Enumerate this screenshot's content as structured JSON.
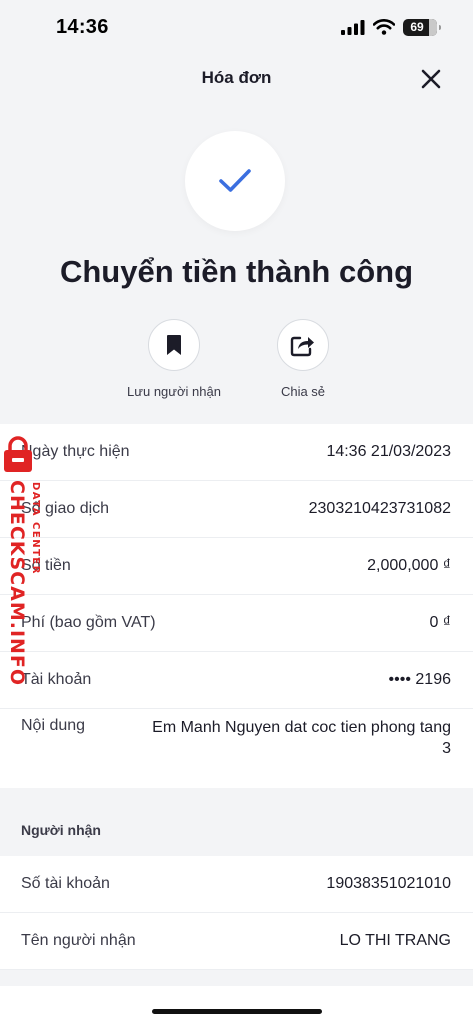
{
  "status_bar": {
    "time": "14:36",
    "battery": "69"
  },
  "header": {
    "title": "Hóa đơn"
  },
  "result": {
    "title": "Chuyển tiền thành công"
  },
  "actions": [
    {
      "label": "Lưu người nhận",
      "icon": "bookmark-icon"
    },
    {
      "label": "Chia sẻ",
      "icon": "share-icon"
    }
  ],
  "details": [
    {
      "label": "Ngày thực hiện",
      "value": "14:36 21/03/2023"
    },
    {
      "label": "Số giao dịch",
      "value": "2303210423731082"
    },
    {
      "label": "Số tiền",
      "value": "2,000,000 ₫"
    },
    {
      "label": "Phí (bao gồm VAT)",
      "value": "0 ₫"
    },
    {
      "label": "Tài khoản",
      "value": "•••• 2196"
    },
    {
      "label": "Nội dung",
      "value": "Em Manh Nguyen dat coc tien phong tang 3"
    }
  ],
  "recipient": {
    "section_title": "Người nhận",
    "rows": [
      {
        "label": "Số tài khoản",
        "value": "19038351021010"
      },
      {
        "label": "Tên người nhận",
        "value": "LO THI TRANG"
      }
    ]
  },
  "watermark": {
    "main": "CHECKSCAM.INFO",
    "sub": "DATA CENTER"
  },
  "colors": {
    "accent": "#3b6fe0",
    "watermark": "#e02424",
    "background": "#f3f4f6"
  }
}
